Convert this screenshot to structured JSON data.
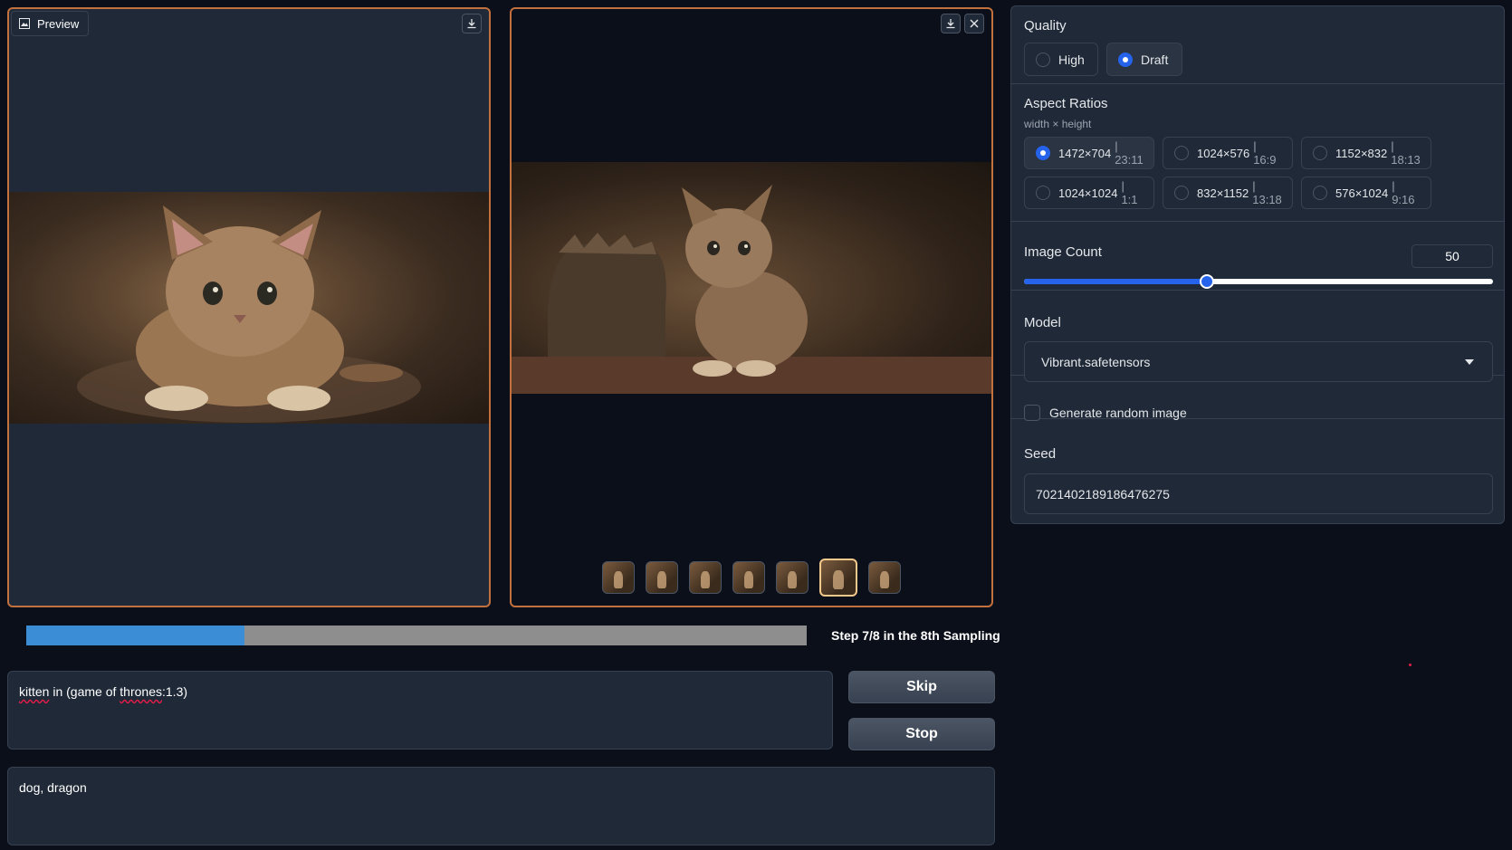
{
  "preview": {
    "tag_label": "Preview",
    "image_alt": "Kitten lying on floor"
  },
  "gallery": {
    "image_alt": "Kitten sitting on floor",
    "thumbnail_count": 7,
    "selected_index": 5
  },
  "progress": {
    "fraction": 0.28,
    "text": "Step 7/8 in the 8th Sampling"
  },
  "prompt": {
    "value": "kitten in (game of thrones:1.3)",
    "misspelled_words": [
      "kitten",
      "thrones"
    ]
  },
  "negative_prompt": {
    "value": "dog, dragon"
  },
  "buttons": {
    "skip_label": "Skip",
    "stop_label": "Stop"
  },
  "settings": {
    "quality": {
      "label": "Quality",
      "options": [
        {
          "label": "High",
          "selected": false
        },
        {
          "label": "Draft",
          "selected": true
        }
      ]
    },
    "aspect_ratios": {
      "label": "Aspect Ratios",
      "sublabel": "width × height",
      "options": [
        {
          "size": "1472×704",
          "ratio": "| 23:11",
          "selected": true
        },
        {
          "size": "1024×576",
          "ratio": "| 16:9",
          "selected": false
        },
        {
          "size": "1152×832",
          "ratio": "| 18:13",
          "selected": false
        },
        {
          "size": "1024×1024",
          "ratio": "| 1:1",
          "selected": false
        },
        {
          "size": "832×1152",
          "ratio": "| 13:18",
          "selected": false
        },
        {
          "size": "576×1024",
          "ratio": "| 9:16",
          "selected": false
        }
      ]
    },
    "image_count": {
      "label": "Image Count",
      "value": "50",
      "slider_fraction": 0.39
    },
    "model": {
      "label": "Model",
      "value": "Vibrant.safetensors"
    },
    "random": {
      "label": "Generate random image",
      "checked": false
    },
    "seed": {
      "label": "Seed",
      "value": "7021402189186476275"
    }
  },
  "colors": {
    "accent": "#2563eb",
    "panel_border": "#c2703d",
    "progress": "#3b8ed6"
  }
}
